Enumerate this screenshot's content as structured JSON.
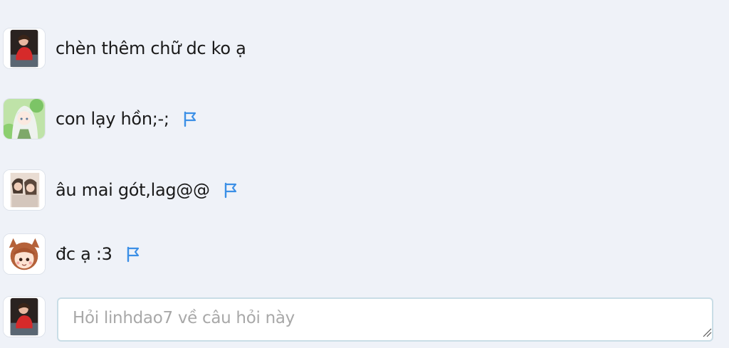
{
  "comments": [
    {
      "text": "chèn thêm chữ dc ko ạ",
      "avatar": "user-avatar-red-shirt",
      "flag": false
    },
    {
      "text": "con lạy hồn;-;",
      "avatar": "user-avatar-anime-girl-green",
      "flag": true
    },
    {
      "text": "âu mai gót,lag@@",
      "avatar": "user-avatar-two-people",
      "flag": true
    },
    {
      "text": "đc ạ :3",
      "avatar": "user-avatar-chibi-brown-hair",
      "flag": true
    }
  ],
  "reply": {
    "placeholder": "Hỏi linhdao7 về câu hỏi này",
    "avatar": "current-user-avatar-red-shirt"
  },
  "colors": {
    "background": "#eff2f8",
    "flag": "#3b8fe6",
    "input_border": "#c9dde6"
  },
  "icons": {
    "flag": "flag-icon",
    "resize": "resize-grip-icon"
  }
}
